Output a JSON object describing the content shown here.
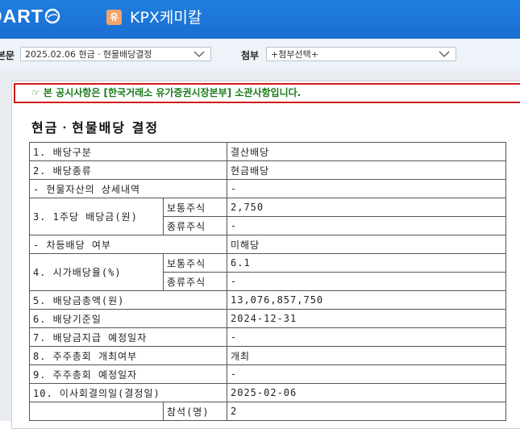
{
  "header": {
    "logo_text": "DART",
    "corp_badge": "유",
    "corp_name": "KPX케미칼"
  },
  "toolbar": {
    "report_label": "본문",
    "report_select_value": "2025.02.06  현금ㆍ현물배당결정",
    "attach_label": "첨부",
    "attach_select_value": "+첨부선택+"
  },
  "notice": "☞ 본 공시사항은 [한국거래소 유가증권시장본부] 소관사항입니다.",
  "doc_title": "현금ㆍ현물배당 결정",
  "table": {
    "r1": {
      "label": "1. 배당구분",
      "value": "결산배당"
    },
    "r2": {
      "label": "2. 배당종류",
      "value": "현금배당"
    },
    "r3": {
      "label": "- 현물자산의 상세내역",
      "value": "-"
    },
    "r4": {
      "label": "3. 1주당 배당금(원)",
      "sub1": "보통주식",
      "val1": "2,750",
      "sub2": "종류주식",
      "val2": "-"
    },
    "r5": {
      "label": "- 차등배당 여부",
      "value": "미해당"
    },
    "r6": {
      "label": "4. 시가배당율(%)",
      "sub1": "보통주식",
      "val1": "6.1",
      "sub2": "종류주식",
      "val2": "-"
    },
    "r7": {
      "label": "5. 배당금총액(원)",
      "value": "13,076,857,750"
    },
    "r8": {
      "label": "6. 배당기준일",
      "value": "2024-12-31"
    },
    "r9": {
      "label": "7. 배당금지급 예정일자",
      "value": "-"
    },
    "r10": {
      "label": "8. 주주총회 개최여부",
      "value": "개최"
    },
    "r11": {
      "label": "9. 주주총회 예정일자",
      "value": "-"
    },
    "r12": {
      "label": "10. 이사회결의일(결정일)",
      "value": "2025-02-06"
    },
    "r13": {
      "sub": "참석(명)",
      "value": "2"
    }
  },
  "colors": {
    "header_blue": "#1e7fe0",
    "notice_border": "#d01b1b",
    "notice_text": "#1a7a1a"
  }
}
